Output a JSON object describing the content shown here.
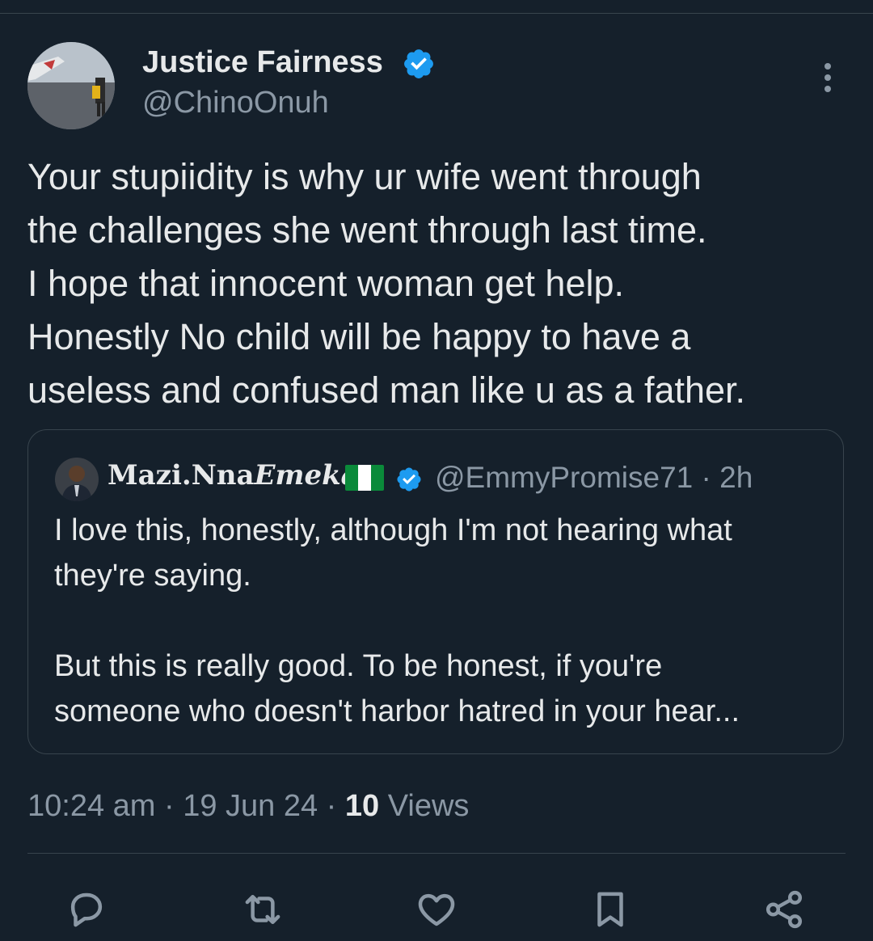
{
  "tweet": {
    "author": {
      "name": "Justice Fairness",
      "handle": "@ChinoOnuh",
      "verified": true
    },
    "text_lines": [
      "Your stupiidity is why ur wife went through",
      "the challenges she went through last time.",
      "I hope that innocent woman get help.",
      "Honestly No child will be happy to have a",
      "useless and confused man like u as a father."
    ],
    "quote": {
      "name_regular": "Mazi.Nna",
      "name_italic": "Emeka",
      "flag": "nigeria-flag",
      "handle_time": "@EmmyPromise71 · 2h",
      "text_lines": [
        "I love this, honestly, although I'm not hearing what",
        "they're saying.",
        "",
        "But this is really good. To be honest, if you're",
        "someone who doesn't harbor hatred in your hear..."
      ]
    },
    "time": "10:24 am · 19 Jun 24 · ",
    "views_count": "10",
    "views_label": " Views",
    "actions": [
      "reply-icon",
      "retweet-icon",
      "like-icon",
      "bookmark-icon",
      "share-icon"
    ]
  },
  "colors": {
    "background": "#15202b",
    "text": "#e7e9ea",
    "secondary_text": "#8b98a5",
    "verified_blue": "#1d9bf0",
    "border": "#38444d"
  }
}
